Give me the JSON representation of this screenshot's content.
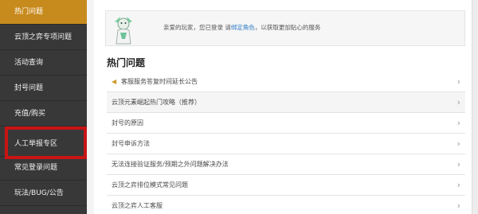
{
  "sidebar": {
    "items": [
      {
        "label": "热门问题",
        "active": true
      },
      {
        "label": "云顶之弈专项问题"
      },
      {
        "label": "活动查询"
      },
      {
        "label": "封号问题"
      },
      {
        "label": "充值/购买"
      },
      {
        "label": "人工举报专区"
      },
      {
        "label": "常见登录问题"
      },
      {
        "label": "玩法/BUG/公告"
      }
    ]
  },
  "notice": {
    "text_before": "亲爱的玩家，您已登录 请",
    "link": "绑定角色",
    "text_after": "，以获取更加贴心的服务"
  },
  "section": {
    "title": "热门问题"
  },
  "faq": [
    {
      "label": "客服服务答复时间延长公告",
      "icon": "speaker-icon"
    },
    {
      "label": "云顶元素崛起热门攻略（推荐）"
    },
    {
      "label": "封号的原因"
    },
    {
      "label": "封号申诉方法"
    },
    {
      "label": "无法连接验证服务/预期之外问题解决办法"
    },
    {
      "label": "云顶之弈排位模式常见问题"
    },
    {
      "label": "云顶之弈人工客服"
    }
  ],
  "colors": {
    "active_tab": "#c78a1c",
    "highlight": "#c81414",
    "link": "#2f7cc6"
  }
}
